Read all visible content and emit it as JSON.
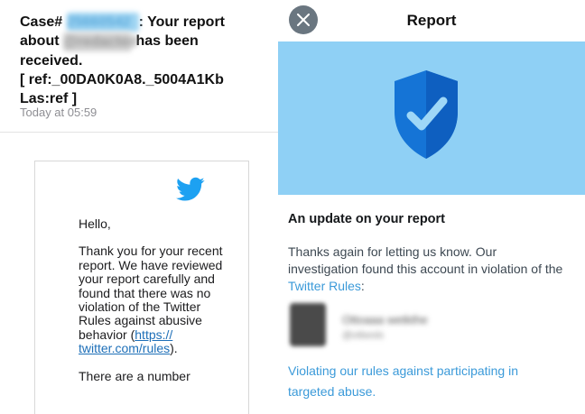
{
  "email": {
    "subject_lines": [
      {
        "before": "Case# ",
        "redacted": "25660542",
        "after": ": Your report"
      },
      {
        "before": "about ",
        "redacted": "@redacted",
        "after": " has been"
      },
      {
        "before": "received.",
        "redacted": "",
        "after": ""
      },
      {
        "before": "[ ref:_00DA0K0A8._5004A1Kb",
        "redacted": "",
        "after": ""
      },
      {
        "before": "Las:ref ]",
        "redacted": "",
        "after": ""
      }
    ],
    "timestamp": "Today at 05:59",
    "logo_icon": "twitter-bird-icon",
    "greeting": "Hello,",
    "body_text": "Thank you for your recent report. We have reviewed your report carefully and found that there was no violation of the Twitter Rules against abusive behavior (",
    "rules_link": "https://\ntwitter.com/rules",
    "body_end": ").",
    "next_para": "There are a number"
  },
  "report": {
    "title": "Report",
    "close_icon": "close-icon",
    "banner_icon": "shield-check-icon",
    "heading": "An update on your report",
    "body_text": "Thanks again for letting us know. Our investigation found this account in violation of the ",
    "rules_link": "Twitter Rules",
    "body_end": ":",
    "account_name": "Ottoaaa wetkthe",
    "account_handle": "@otbesls",
    "violation_text": "Violating our rules against participating in targeted abuse."
  },
  "colors": {
    "twitter_blue": "#1da1f2",
    "banner": "#8fd0f5",
    "shield": "#1574d6",
    "link": "#3b9ad9"
  }
}
